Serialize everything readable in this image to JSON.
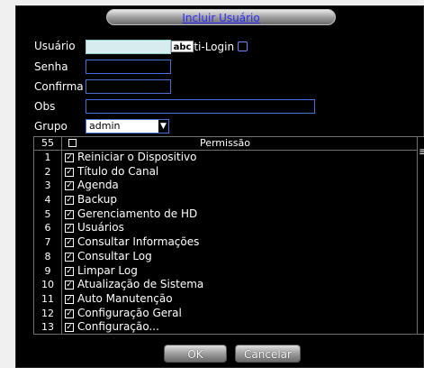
{
  "dialog": {
    "title": "Incluir Usuário"
  },
  "form": {
    "usuario_label": "Usuário",
    "usuario_value": "",
    "abc_label": "abc",
    "multilogin_label": "lti-Login",
    "senha_label": "Senha",
    "confirma_label": "Confirma",
    "obs_label": "Obs",
    "grupo_label": "Grupo",
    "grupo_value": "admin"
  },
  "table": {
    "count": "55",
    "header": "Permissão",
    "rows": [
      {
        "num": "1",
        "label": "Reiniciar o Dispositivo"
      },
      {
        "num": "2",
        "label": "Título do Canal"
      },
      {
        "num": "3",
        "label": "Agenda"
      },
      {
        "num": "4",
        "label": "Backup"
      },
      {
        "num": "5",
        "label": "Gerenciamento de HD"
      },
      {
        "num": "6",
        "label": "Usuários"
      },
      {
        "num": "7",
        "label": "Consultar Informações"
      },
      {
        "num": "8",
        "label": "Consultar Log"
      },
      {
        "num": "9",
        "label": "Limpar Log"
      },
      {
        "num": "10",
        "label": "Atualização de Sistema"
      },
      {
        "num": "11",
        "label": "Auto Manutenção"
      },
      {
        "num": "12",
        "label": "Configuração Geral"
      },
      {
        "num": "13",
        "label": "Configuração..."
      }
    ]
  },
  "buttons": {
    "ok": "OK",
    "cancel": "Cancelar"
  },
  "colors": {
    "accent": "#2b2bff",
    "field_border": "#4a6fd6"
  }
}
